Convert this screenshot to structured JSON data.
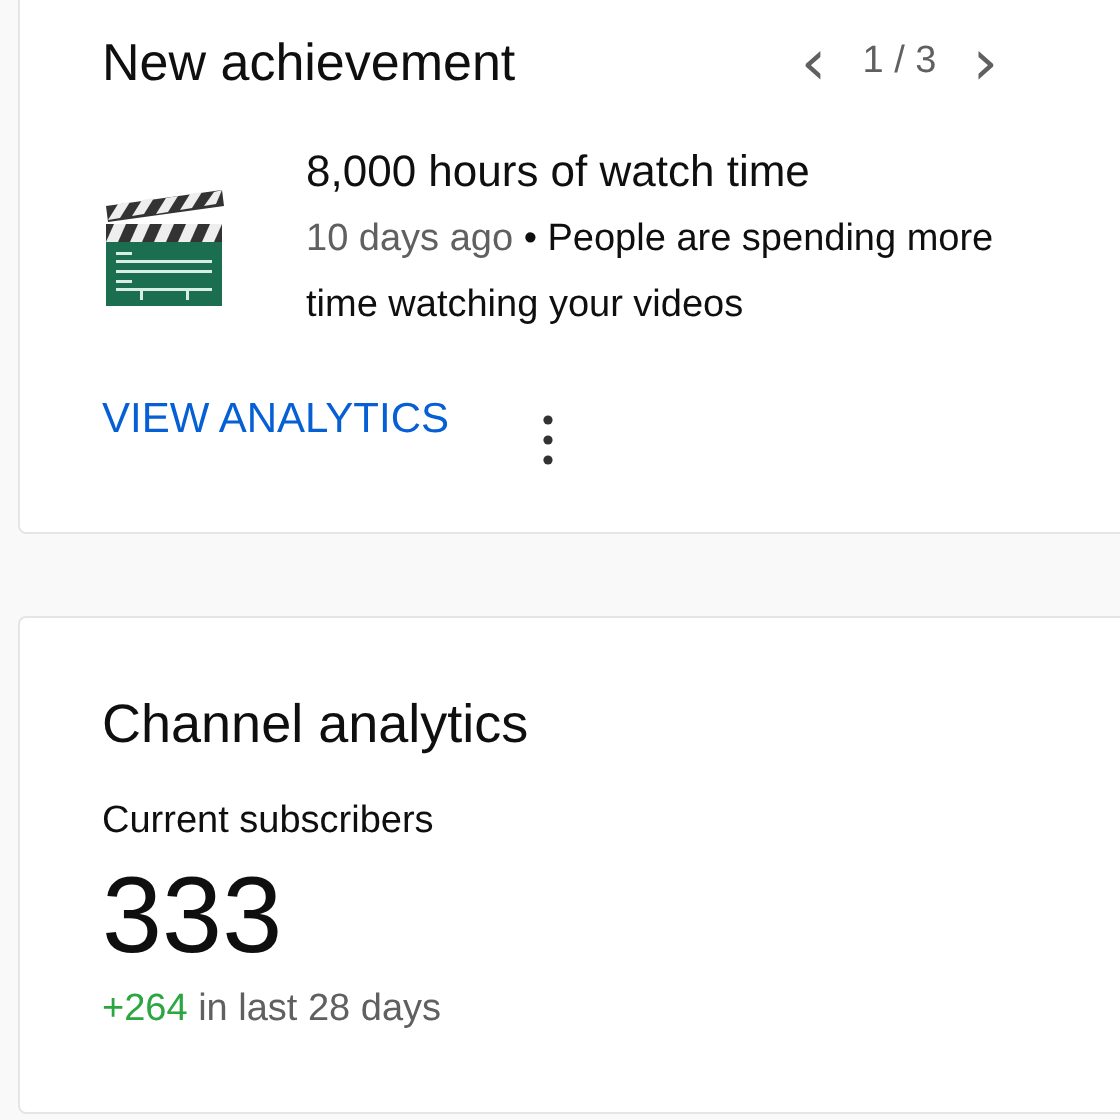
{
  "achievement_card": {
    "title": "New achievement",
    "pager": {
      "previous": "‹",
      "position": "1 / 3",
      "next": "›"
    },
    "achievement": {
      "title": "8,000 hours of watch time",
      "age": "10 days ago",
      "separator": "•",
      "description": "People are spending more time watching your videos"
    },
    "action": "VIEW ANALYTICS"
  },
  "analytics_card": {
    "title": "Channel analytics",
    "metric_label": "Current subscribers",
    "metric_value": "333",
    "change": "+264",
    "period": "in last 28 days"
  }
}
